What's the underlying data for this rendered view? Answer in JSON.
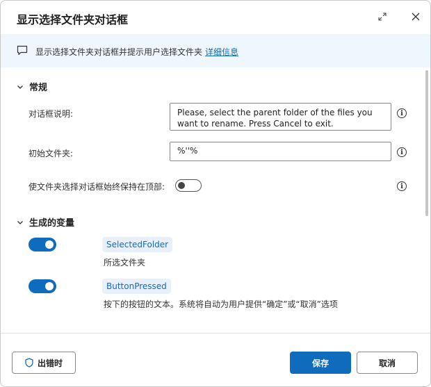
{
  "dialog": {
    "title": "显示选择文件夹对话框"
  },
  "banner": {
    "text": "显示选择文件夹对话框并提示用户选择文件夹",
    "link": "详细信息"
  },
  "general": {
    "section_label": "常规",
    "dialog_desc_label": "对话框说明:",
    "dialog_desc_value": "Please, select the parent folder of the files you want to rename. Press Cancel to exit.",
    "initial_folder_label": "初始文件夹:",
    "initial_folder_value": "%''%",
    "keep_on_top_label": "使文件夹选择对话框始终保持在顶部:",
    "keep_on_top": false
  },
  "variables": {
    "section_label": "生成的变量",
    "items": [
      {
        "name": "SelectedFolder",
        "desc": "所选文件夹",
        "enabled": true
      },
      {
        "name": "ButtonPressed",
        "desc": "按下的按钮的文本。系统将自动为用户提供“确定”或“取消”选项",
        "enabled": true
      }
    ]
  },
  "footer": {
    "on_error_label": "出错时",
    "save_label": "保存",
    "cancel_label": "取消"
  },
  "icons": {
    "expand": "expand-icon",
    "close": "close-icon",
    "chat": "chat-icon",
    "chevron": "chevron-down-icon",
    "info": "info-icon",
    "shield": "shield-icon"
  },
  "colors": {
    "accent": "#0f6cbd",
    "banner_bg": "#f0f6fd",
    "chip_bg": "#e8f1fb"
  }
}
